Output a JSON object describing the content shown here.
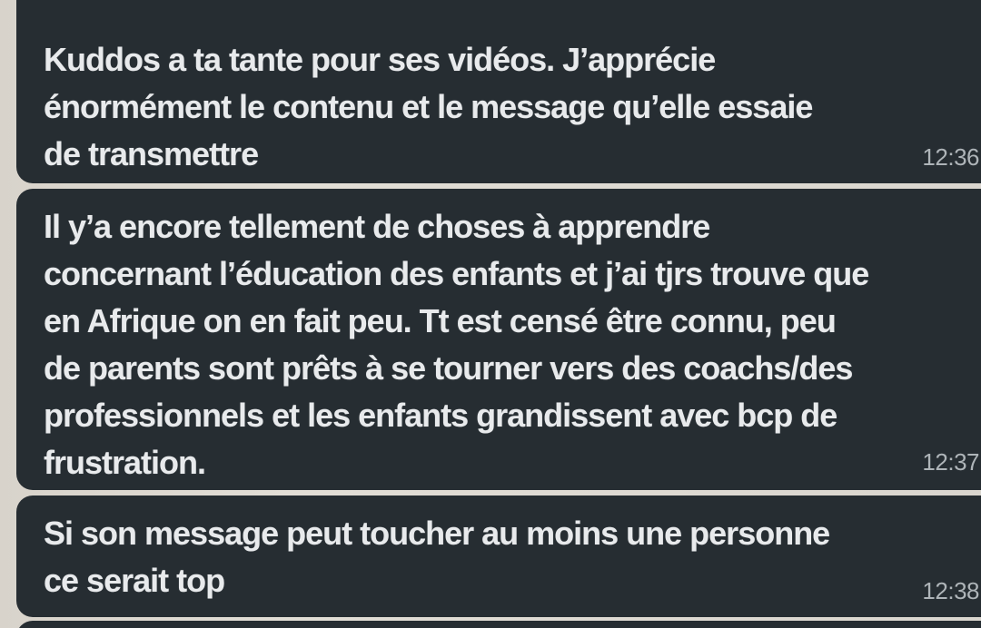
{
  "messages": [
    {
      "text": "Kuddos a ta tante pour ses vidéos. J’apprécie\nénormément le contenu  et le message qu’elle essaie\nde transmettre",
      "time": "12:36"
    },
    {
      "text": "Il y’a encore tellement de choses à apprendre\nconcernant l’éducation des enfants et j’ai tjrs trouve que\nen Afrique on en fait peu. Tt est censé être connu, peu\nde parents sont prêts à se tourner vers des coachs/des\nprofessionnels et les enfants grandissent avec bcp de\nfrustration.",
      "time": "12:37"
    },
    {
      "text": "Si son message peut toucher au moins une personne\nce serait top",
      "time": "12:38"
    }
  ],
  "colors": {
    "bubble": "#262d32",
    "text": "#e8eaec",
    "timestamp": "#aeb4b8",
    "background": "#dad6cf",
    "accent": "#c98ad8"
  }
}
